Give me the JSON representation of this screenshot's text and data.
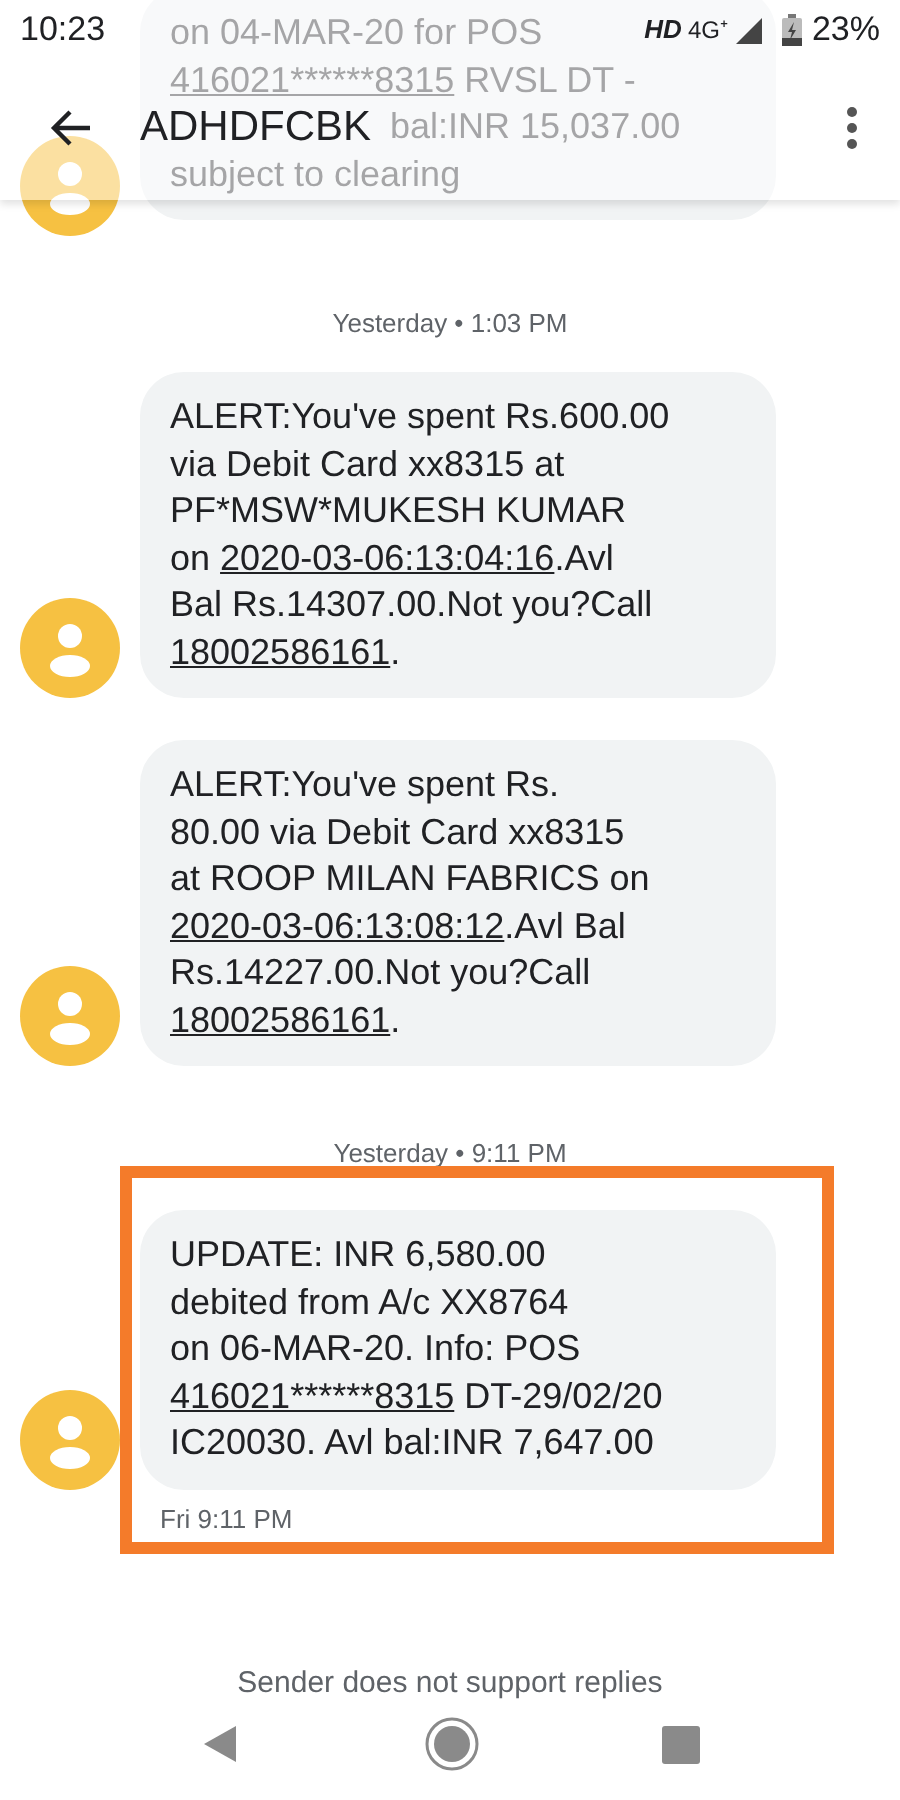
{
  "status_bar": {
    "time": "10:23",
    "hd": "HD",
    "network": "4G⁺",
    "battery": "23%"
  },
  "app_bar": {
    "title": "ADHDFCBK"
  },
  "scrolled_message": {
    "lines": [
      [
        {
          "text": "on 04-MAR-20 for POS",
          "link": false
        }
      ],
      [
        {
          "text": "416021******8315",
          "link": true
        },
        {
          "text": " RVSL DT -",
          "link": false
        }
      ],
      [
        {
          "text": "bal:INR 15,037.00",
          "link": false
        }
      ],
      [
        {
          "text": "subject to clearing",
          "link": false
        }
      ]
    ]
  },
  "thread": [
    {
      "kind": "timestamp",
      "text": "Yesterday • 1:03 PM"
    },
    {
      "kind": "message",
      "highlighted": false,
      "lines": [
        [
          {
            "text": "ALERT:You've spent Rs.600.00",
            "link": false
          }
        ],
        [
          {
            "text": "via Debit Card xx8315 at",
            "link": false
          }
        ],
        [
          {
            "text": "PF*MSW*MUKESH KUMAR",
            "link": false
          }
        ],
        [
          {
            "text": "on ",
            "link": false
          },
          {
            "text": "2020-03-06:13:04:16",
            "link": true
          },
          {
            "text": ".Avl",
            "link": false
          }
        ],
        [
          {
            "text": "Bal Rs.14307.00.Not you?Call",
            "link": false
          }
        ],
        [
          {
            "text": "18002586161",
            "link": true
          },
          {
            "text": ".",
            "link": false
          }
        ]
      ]
    },
    {
      "kind": "message",
      "highlighted": false,
      "lines": [
        [
          {
            "text": "ALERT:You've spent Rs.",
            "link": false
          }
        ],
        [
          {
            "text": "80.00 via Debit Card xx8315",
            "link": false
          }
        ],
        [
          {
            "text": "at ROOP MILAN FABRICS on",
            "link": false
          }
        ],
        [
          {
            "text": "2020-03-06:13:08:12",
            "link": true
          },
          {
            "text": ".Avl Bal",
            "link": false
          }
        ],
        [
          {
            "text": "Rs.14227.00.Not you?Call",
            "link": false
          }
        ],
        [
          {
            "text": "18002586161",
            "link": true
          },
          {
            "text": ".",
            "link": false
          }
        ]
      ]
    },
    {
      "kind": "timestamp",
      "text": "Yesterday • 9:11 PM"
    },
    {
      "kind": "message",
      "highlighted": true,
      "time": "Fri 9:11 PM",
      "lines": [
        [
          {
            "text": "UPDATE: INR 6,580.00",
            "link": false
          }
        ],
        [
          {
            "text": "debited from A/c XX8764",
            "link": false
          }
        ],
        [
          {
            "text": "on 06-MAR-20. Info: POS",
            "link": false
          }
        ],
        [
          {
            "text": "416021******8315",
            "link": true
          },
          {
            "text": " DT-29/02/20",
            "link": false
          }
        ],
        [
          {
            "text": "IC20030. Avl bal:INR 7,647.00",
            "link": false
          }
        ]
      ]
    }
  ],
  "footer": {
    "notice": "Sender does not support replies"
  }
}
